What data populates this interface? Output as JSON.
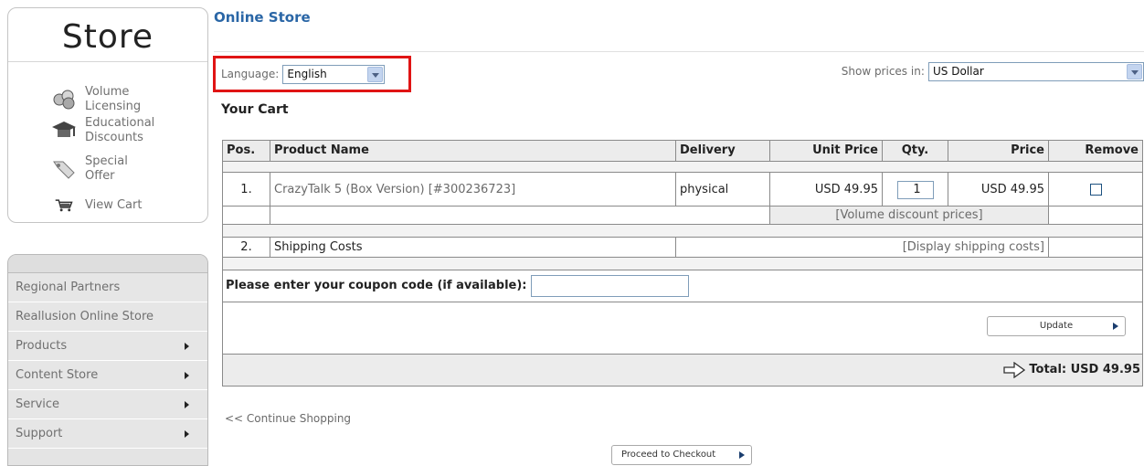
{
  "store": {
    "title": "Store",
    "items": [
      {
        "line1": "Volume",
        "line2": "Licensing",
        "icon": "people-icon"
      },
      {
        "line1": "Educational",
        "line2": "Discounts",
        "icon": "graduation-cap-icon"
      },
      {
        "line1": "Special",
        "line2": "Offer",
        "icon": "tag-icon"
      },
      {
        "line1": "View Cart",
        "line2": "",
        "icon": "shopping-cart-icon"
      }
    ]
  },
  "nav": {
    "items": [
      {
        "label": "Regional Partners",
        "arrow": false
      },
      {
        "label": "Reallusion Online Store",
        "arrow": false
      },
      {
        "label": "Products",
        "arrow": true
      },
      {
        "label": "Content Store",
        "arrow": true
      },
      {
        "label": "Service",
        "arrow": true
      },
      {
        "label": "Support",
        "arrow": true
      }
    ]
  },
  "page": {
    "title": "Online Store",
    "language_label": "Language:",
    "language_value": "English",
    "prices_label": "Show prices in:",
    "prices_value": "US Dollar",
    "cart_title": "Your Cart"
  },
  "table": {
    "headers": {
      "pos": "Pos.",
      "product": "Product Name",
      "delivery": "Delivery",
      "unit_price": "Unit Price",
      "qty": "Qty.",
      "price": "Price",
      "remove": "Remove"
    },
    "item": {
      "pos": "1.",
      "product": "CrazyTalk 5 (Box Version) [#300236723]",
      "delivery": "physical",
      "unit_price": "USD 49.95",
      "qty": "1",
      "price": "USD 49.95"
    },
    "volume_link": "[Volume discount prices]",
    "shipping": {
      "pos": "2.",
      "label": "Shipping Costs",
      "link": "[Display shipping costs]"
    },
    "coupon_label": "Please enter your coupon code (if available):",
    "update_label": "Update",
    "total": "Total: USD 49.95"
  },
  "footer": {
    "continue": "<< Continue Shopping",
    "checkout": "Proceed to Checkout"
  },
  "colors": {
    "title_blue": "#2a66a6",
    "highlight_red": "#e01414"
  }
}
